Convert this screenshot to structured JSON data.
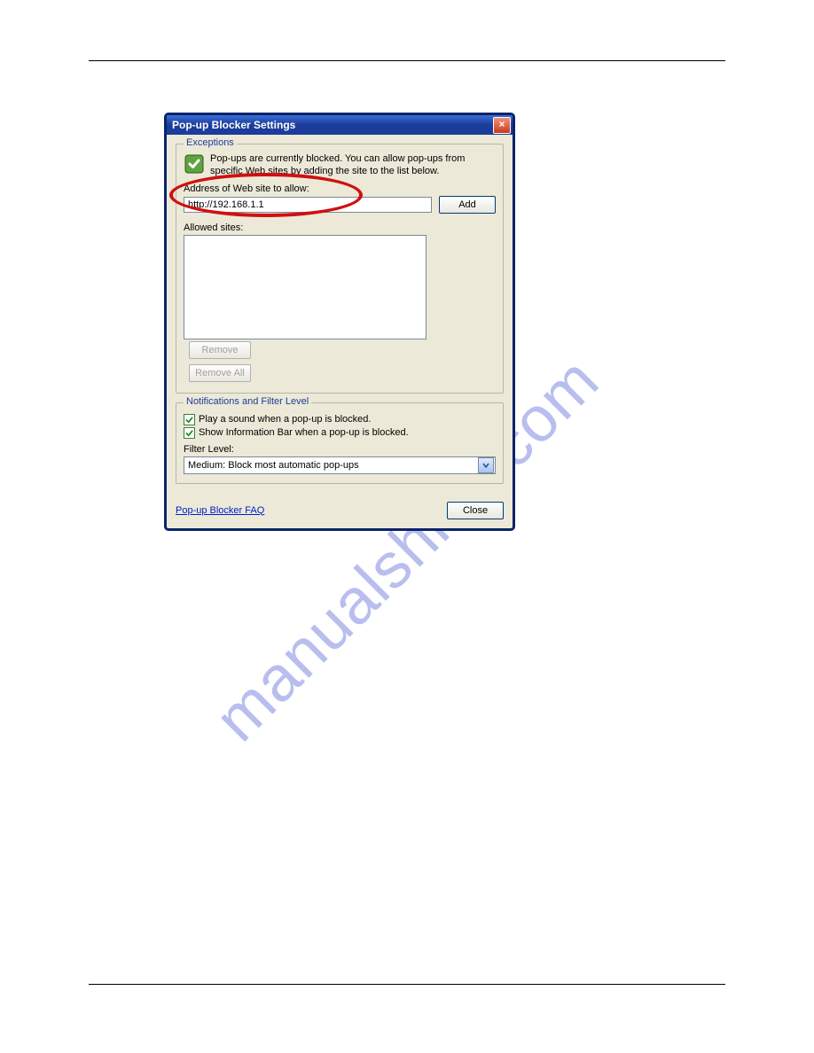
{
  "dialog": {
    "title": "Pop-up Blocker Settings",
    "exceptions_group_label": "Exceptions",
    "info_text": "Pop-ups are currently blocked.  You can allow pop-ups from specific Web sites by adding the site to the list below.",
    "address_label": "Address of Web site to allow:",
    "address_value": "http://192.168.1.1",
    "add_label": "Add",
    "allowed_sites_label": "Allowed sites:",
    "remove_label": "Remove",
    "remove_all_label": "Remove All",
    "notifications_group_label": "Notifications and Filter Level",
    "chk1_label": "Play a sound when a pop-up is blocked.",
    "chk2_label": "Show Information Bar when a pop-up is blocked.",
    "filter_label": "Filter Level:",
    "filter_selected": "Medium: Block most automatic pop-ups",
    "faq_link": "Pop-up Blocker FAQ",
    "close_label": "Close"
  },
  "watermark": "manualshive.com"
}
